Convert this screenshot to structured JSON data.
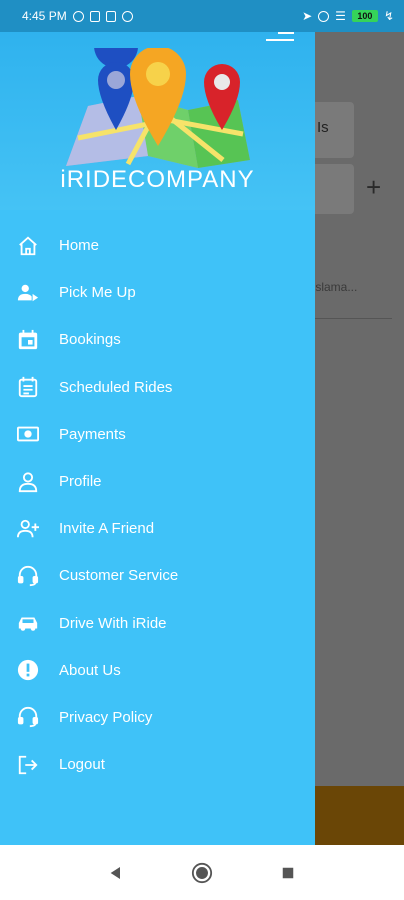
{
  "status_bar": {
    "time": "4:45 PM",
    "battery": "100"
  },
  "background": {
    "address_snippet": "ad, Is",
    "subtitle_snippet": "Islama...",
    "plus_label": "+"
  },
  "drawer": {
    "brand": "iRIDECOMPANY",
    "items": [
      {
        "label": "Home",
        "icon": "home-icon"
      },
      {
        "label": "Pick Me Up",
        "icon": "person-pickup-icon"
      },
      {
        "label": "Bookings",
        "icon": "calendar-icon"
      },
      {
        "label": "Scheduled Rides",
        "icon": "schedule-list-icon"
      },
      {
        "label": "Payments",
        "icon": "money-icon"
      },
      {
        "label": "Profile",
        "icon": "profile-icon"
      },
      {
        "label": "Invite A Friend",
        "icon": "add-person-icon"
      },
      {
        "label": "Customer Service",
        "icon": "headset-icon"
      },
      {
        "label": "Drive With iRide",
        "icon": "car-icon"
      },
      {
        "label": "About Us",
        "icon": "info-icon"
      },
      {
        "label": "Privacy Policy",
        "icon": "headset-icon"
      },
      {
        "label": "Logout",
        "icon": "logout-icon"
      }
    ]
  },
  "colors": {
    "drawer_bg": "#3fc2f8",
    "status_bar": "#1f8fc4",
    "scrim": "#6a6a6a"
  }
}
